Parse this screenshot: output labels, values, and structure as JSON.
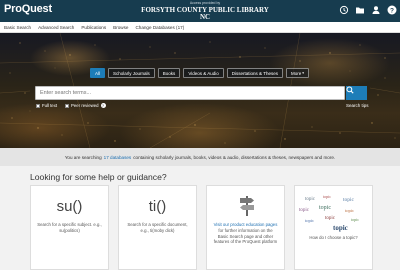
{
  "header": {
    "logo": "ProQuest",
    "provided_by": "Access provided by",
    "library": "FORSYTH COUNTY PUBLIC LIBRARY NC",
    "icons": [
      "history-icon",
      "folder-icon",
      "user-icon",
      "help-icon"
    ]
  },
  "subnav": [
    "Basic Search",
    "Advanced Search",
    "Publications",
    "Browse",
    "Change Databases (17)"
  ],
  "search": {
    "tabs": [
      "All",
      "Scholarly Journals",
      "Books",
      "Videos & Audio",
      "Dissertations & Theses",
      "More"
    ],
    "placeholder": "Enter search terms...",
    "fulltext_label": "Full text",
    "peer_label": "Peer reviewed",
    "tips_label": "Search tips"
  },
  "info": {
    "prefix": "You are searching",
    "link": "17 databases",
    "suffix": "containing scholarly journals, books, videos & audio, dissertations & theses, newspapers and more."
  },
  "guidance": {
    "title": "Looking for some help or guidance?",
    "cards": [
      {
        "big": "su()",
        "text": "Search for a specific subject. e.g., su(politics)"
      },
      {
        "big": "ti()",
        "text": "Search for a specific document, e.g., ti(moby dick)"
      },
      {
        "text_link": "Visit our product education pages",
        "text_rest": "for further information on the Basic Search page and other features of the ProQuest platform"
      },
      {
        "caption": "How do I choose a topic?",
        "words": [
          "topic",
          "topic",
          "topic",
          "topic",
          "topic",
          "topic",
          "topic",
          "topic",
          "topic",
          "topic"
        ]
      }
    ]
  },
  "colors": {
    "header_bg": "#173c4f",
    "accent": "#1d7db8",
    "link": "#1d6fb1"
  }
}
